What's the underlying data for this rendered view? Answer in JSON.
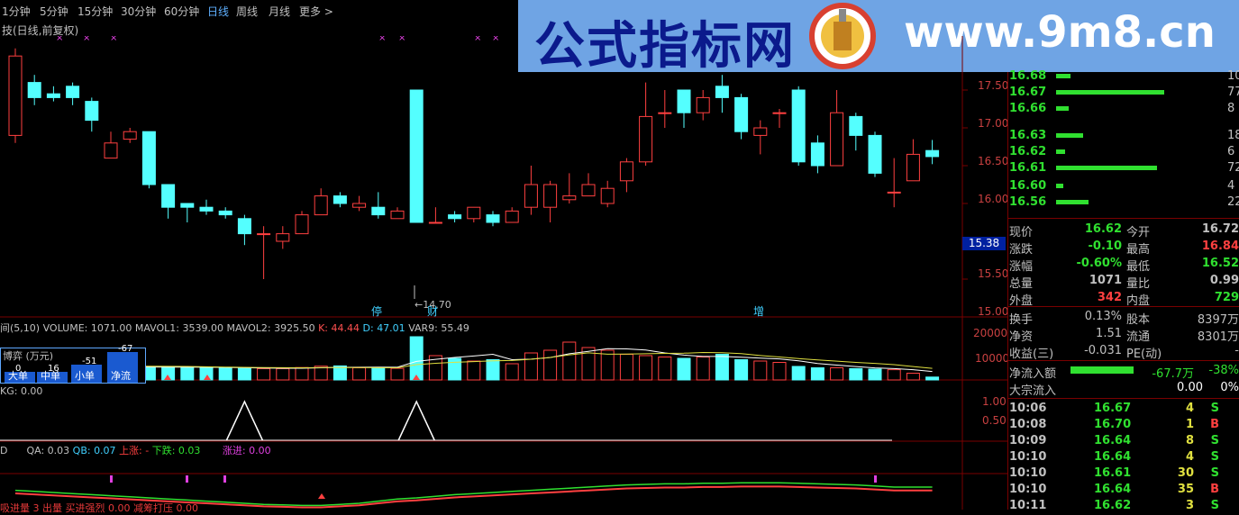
{
  "toolbar": {
    "periods": [
      "1分钟",
      "5分钟",
      "15分钟",
      "30分钟",
      "60分钟",
      "日线",
      "周线",
      "月线",
      "更多 >"
    ],
    "active": "日线"
  },
  "chart_title": "技(日线,前复权)",
  "banner": {
    "title": "公式指标网",
    "url": "www.9m8.cn"
  },
  "price_axis": [
    "17.50",
    "17.00",
    "16.50",
    "16.00",
    "15.50",
    "15.00"
  ],
  "current_price_tag": "15.38",
  "low_marker": "←14.70",
  "event_markers": [
    "停",
    "财",
    "增"
  ],
  "volume_indicator": {
    "header_prefix": "间(5,10)",
    "volume": "VOLUME: 1071.00",
    "mavol1": "MAVOL1: 3539.00",
    "mavol2": "MAVOL2: 3925.50",
    "k": "K: 44.44",
    "d": "D: 47.01",
    "var9": "VAR9: 55.49",
    "axis": [
      "20000",
      "10000"
    ]
  },
  "game_box": {
    "title": "博弈 (万元)",
    "values": [
      "0",
      "16",
      "-51",
      "-67"
    ],
    "labels": [
      "大单",
      "中单",
      "小单",
      "净流"
    ]
  },
  "kg_indicator": {
    "header": "KG: 0.00",
    "axis": [
      "1.00",
      "0.50"
    ]
  },
  "qa_indicator": {
    "prefix": "D",
    "qa": "QA: 0.03",
    "qb": "QB: 0.07",
    "up": "上涨: -",
    "down": "下跌: 0.03",
    "buy": "涨进: 0.00",
    "bottom_text": "吸进量 3 出量 买进强烈 0.00 减筹打压 0.00"
  },
  "order_book": [
    {
      "price": "16.68",
      "vol": "10",
      "bar": 0.08
    },
    {
      "price": "16.67",
      "vol": "77",
      "bar": 0.6
    },
    {
      "price": "16.66",
      "vol": "8",
      "bar": 0.07
    },
    {
      "price": "16.63",
      "vol": "18",
      "bar": 0.15
    },
    {
      "price": "16.62",
      "vol": "6",
      "bar": 0.05
    },
    {
      "price": "16.61",
      "vol": "72",
      "bar": 0.56
    },
    {
      "price": "16.60",
      "vol": "4",
      "bar": 0.04
    },
    {
      "price": "16.56",
      "vol": "22",
      "bar": 0.18
    }
  ],
  "quote": [
    {
      "l1": "现价",
      "v1": "16.62",
      "c1": "#30e030",
      "l2": "今开",
      "v2": "16.72",
      "c2": "#c0c0c0"
    },
    {
      "l1": "涨跌",
      "v1": "-0.10",
      "c1": "#30e030",
      "l2": "最高",
      "v2": "16.84",
      "c2": "#ff4040"
    },
    {
      "l1": "涨幅",
      "v1": "-0.60%",
      "c1": "#30e030",
      "l2": "最低",
      "v2": "16.52",
      "c2": "#30e030"
    },
    {
      "l1": "总量",
      "v1": "1071",
      "c1": "#c0c0c0",
      "l2": "量比",
      "v2": "0.99",
      "c2": "#c0c0c0"
    },
    {
      "l1": "外盘",
      "v1": "342",
      "c1": "#ff4040",
      "l2": "内盘",
      "v2": "729",
      "c2": "#30e030"
    }
  ],
  "fund": [
    {
      "l1": "换手",
      "v1": "0.13%",
      "l2": "股本",
      "v2": "8397万"
    },
    {
      "l1": "净资",
      "v1": "1.51",
      "l2": "流通",
      "v2": "8301万"
    },
    {
      "l1": "收益(三)",
      "v1": "-0.031",
      "l2": "PE(动)",
      "v2": "-"
    }
  ],
  "flow": {
    "in_label": "净流入额",
    "in_value": "-67.7万",
    "in_pct": "-38%",
    "big_label": "大宗流入",
    "big_value": "0.00",
    "big_pct": "0%"
  },
  "ticks": [
    {
      "time": "10:06",
      "price": "16.67",
      "vol": "4",
      "side": "S"
    },
    {
      "time": "10:08",
      "price": "16.70",
      "vol": "1",
      "side": "B"
    },
    {
      "time": "10:09",
      "price": "16.64",
      "vol": "8",
      "side": "S"
    },
    {
      "time": "10:10",
      "price": "16.64",
      "vol": "4",
      "side": "S"
    },
    {
      "time": "10:10",
      "price": "16.61",
      "vol": "30",
      "side": "S"
    },
    {
      "time": "10:10",
      "price": "16.64",
      "vol": "35",
      "side": "B"
    },
    {
      "time": "10:11",
      "price": "16.62",
      "vol": "3",
      "side": "S"
    }
  ],
  "candles": [
    {
      "o": 16.9,
      "c": 17.95,
      "h": 18.05,
      "l": 16.8
    },
    {
      "o": 17.6,
      "c": 17.4,
      "h": 17.7,
      "l": 17.3
    },
    {
      "o": 17.45,
      "c": 17.4,
      "h": 17.55,
      "l": 17.35
    },
    {
      "o": 17.55,
      "c": 17.4,
      "h": 17.6,
      "l": 17.3
    },
    {
      "o": 17.35,
      "c": 17.1,
      "h": 17.4,
      "l": 16.95
    },
    {
      "o": 16.6,
      "c": 16.8,
      "h": 16.95,
      "l": 16.6
    },
    {
      "o": 16.85,
      "c": 16.95,
      "h": 17.0,
      "l": 16.8
    },
    {
      "o": 16.95,
      "c": 16.25,
      "h": 16.95,
      "l": 16.2
    },
    {
      "o": 16.25,
      "c": 15.95,
      "h": 16.25,
      "l": 15.8
    },
    {
      "o": 16.0,
      "c": 15.95,
      "h": 16.0,
      "l": 15.75
    },
    {
      "o": 15.95,
      "c": 15.9,
      "h": 16.05,
      "l": 15.85
    },
    {
      "o": 15.9,
      "c": 15.85,
      "h": 15.95,
      "l": 15.8
    },
    {
      "o": 15.8,
      "c": 15.6,
      "h": 15.85,
      "l": 15.45
    },
    {
      "o": 15.6,
      "c": 15.6,
      "h": 15.7,
      "l": 15.0
    },
    {
      "o": 15.5,
      "c": 15.6,
      "h": 15.7,
      "l": 15.4
    },
    {
      "o": 15.6,
      "c": 15.85,
      "h": 15.9,
      "l": 15.6
    },
    {
      "o": 15.85,
      "c": 16.1,
      "h": 16.2,
      "l": 15.85
    },
    {
      "o": 16.1,
      "c": 16.0,
      "h": 16.15,
      "l": 15.95
    },
    {
      "o": 15.95,
      "c": 16.0,
      "h": 16.1,
      "l": 15.9
    },
    {
      "o": 15.95,
      "c": 15.85,
      "h": 16.15,
      "l": 15.8
    },
    {
      "o": 15.8,
      "c": 15.9,
      "h": 15.95,
      "l": 15.8
    },
    {
      "o": 17.5,
      "c": 15.75,
      "h": 17.5,
      "l": 15.75
    },
    {
      "o": 15.75,
      "c": 15.75,
      "h": 15.95,
      "l": 15.75
    },
    {
      "o": 15.85,
      "c": 15.8,
      "h": 15.9,
      "l": 15.75
    },
    {
      "o": 15.8,
      "c": 15.95,
      "h": 15.95,
      "l": 15.75
    },
    {
      "o": 15.85,
      "c": 15.75,
      "h": 15.9,
      "l": 15.7
    },
    {
      "o": 15.75,
      "c": 15.9,
      "h": 15.95,
      "l": 15.75
    },
    {
      "o": 15.95,
      "c": 16.25,
      "h": 16.5,
      "l": 15.85
    },
    {
      "o": 15.95,
      "c": 16.25,
      "h": 16.3,
      "l": 15.75
    },
    {
      "o": 16.05,
      "c": 16.1,
      "h": 16.4,
      "l": 16.0
    },
    {
      "o": 16.1,
      "c": 16.25,
      "h": 16.4,
      "l": 16.1
    },
    {
      "o": 16.0,
      "c": 16.2,
      "h": 16.3,
      "l": 15.95
    },
    {
      "o": 16.3,
      "c": 16.55,
      "h": 16.6,
      "l": 16.15
    },
    {
      "o": 16.55,
      "c": 17.15,
      "h": 17.6,
      "l": 16.5
    },
    {
      "o": 17.2,
      "c": 17.2,
      "h": 17.5,
      "l": 17.0
    },
    {
      "o": 17.5,
      "c": 17.2,
      "h": 17.5,
      "l": 17.0
    },
    {
      "o": 17.2,
      "c": 17.4,
      "h": 17.5,
      "l": 17.1
    },
    {
      "o": 17.55,
      "c": 17.4,
      "h": 17.7,
      "l": 17.2
    },
    {
      "o": 17.4,
      "c": 16.95,
      "h": 17.45,
      "l": 16.85
    },
    {
      "o": 16.9,
      "c": 17.0,
      "h": 17.1,
      "l": 16.65
    },
    {
      "o": 17.2,
      "c": 17.2,
      "h": 17.25,
      "l": 17.0
    },
    {
      "o": 17.5,
      "c": 16.55,
      "h": 17.55,
      "l": 16.5
    },
    {
      "o": 16.8,
      "c": 16.5,
      "h": 16.9,
      "l": 16.4
    },
    {
      "o": 16.5,
      "c": 17.2,
      "h": 17.5,
      "l": 16.5
    },
    {
      "o": 17.15,
      "c": 16.9,
      "h": 17.2,
      "l": 16.7
    },
    {
      "o": 16.9,
      "c": 16.4,
      "h": 16.95,
      "l": 16.35
    },
    {
      "o": 16.15,
      "c": 16.15,
      "h": 16.6,
      "l": 15.95
    },
    {
      "o": 16.3,
      "c": 16.65,
      "h": 16.85,
      "l": 16.3
    },
    {
      "o": 16.7,
      "c": 16.62,
      "h": 16.84,
      "l": 16.52
    }
  ],
  "volumes": [
    6000,
    5500,
    5200,
    5000,
    4800,
    4700,
    4600,
    4800,
    4900,
    4700,
    4500,
    4400,
    4300,
    4200,
    4200,
    4600,
    5100,
    5200,
    4500,
    4400,
    4300,
    16000,
    9000,
    8000,
    7000,
    7500,
    6000,
    10000,
    11000,
    14000,
    12000,
    11000,
    9500,
    9000,
    8500,
    8000,
    8500,
    9500,
    7500,
    7000,
    6500,
    5000,
    4500,
    4500,
    4200,
    4000,
    3800,
    2500,
    1071
  ],
  "kg_peaks": [
    12,
    21
  ],
  "qa_trend": [
    0.16,
    0.18,
    0.2,
    0.22,
    0.24,
    0.26,
    0.28,
    0.3,
    0.32,
    0.34,
    0.36,
    0.38,
    0.4,
    0.42,
    0.43,
    0.44,
    0.44,
    0.42,
    0.4,
    0.36,
    0.32,
    0.3,
    0.27,
    0.24,
    0.22,
    0.2,
    0.18,
    0.16,
    0.14,
    0.12,
    0.1,
    0.08,
    0.06,
    0.05,
    0.04,
    0.04,
    0.03,
    0.03,
    0.02,
    0.02,
    0.02,
    0.03,
    0.04,
    0.05,
    0.06,
    0.08,
    0.1,
    0.1,
    0.1
  ]
}
